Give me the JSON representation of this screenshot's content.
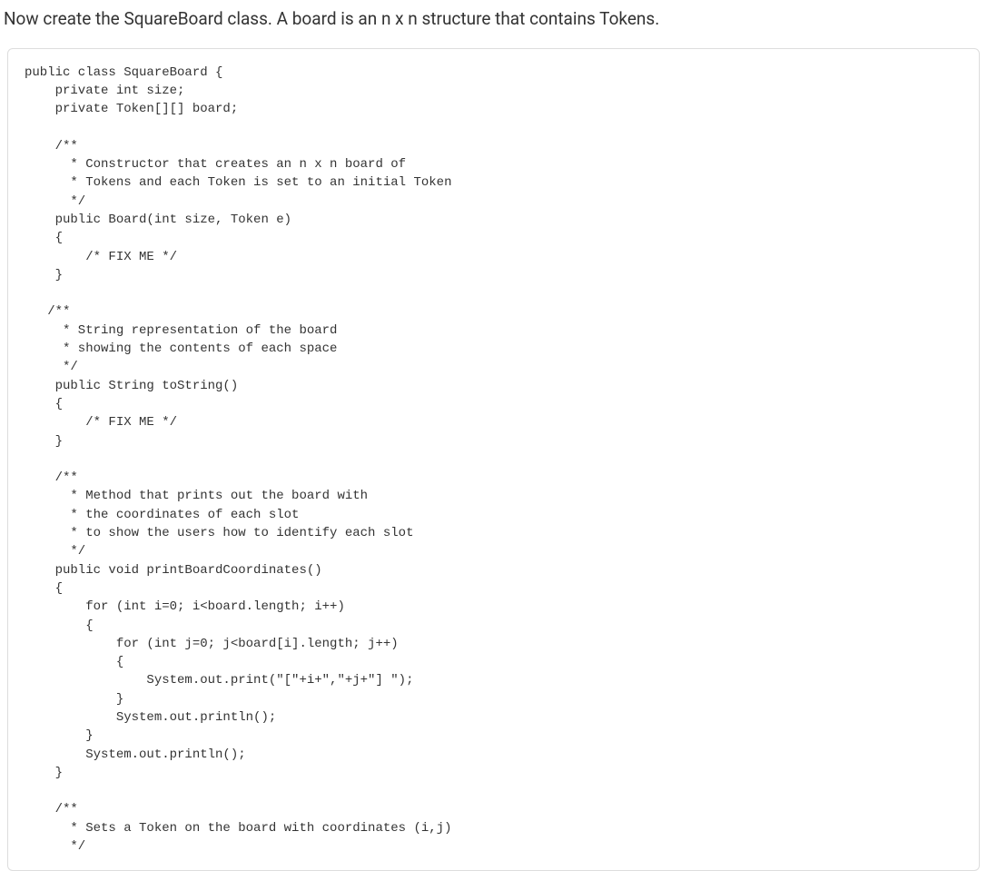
{
  "instruction": "Now create the SquareBoard class. A board is an n x n structure that contains Tokens.",
  "code": "public class SquareBoard {\n    private int size;\n    private Token[][] board;\n\n    /**\n      * Constructor that creates an n x n board of\n      * Tokens and each Token is set to an initial Token\n      */\n    public Board(int size, Token e)\n    {\n        /* FIX ME */\n    }\n\n   /**\n     * String representation of the board\n     * showing the contents of each space\n     */\n    public String toString()\n    {\n        /* FIX ME */\n    }\n\n    /**\n      * Method that prints out the board with\n      * the coordinates of each slot\n      * to show the users how to identify each slot\n      */\n    public void printBoardCoordinates()\n    {\n        for (int i=0; i<board.length; i++)\n        {\n            for (int j=0; j<board[i].length; j++)\n            {\n                System.out.print(\"[\"+i+\",\"+j+\"] \");\n            }\n            System.out.println();\n        }\n        System.out.println();\n    }\n\n    /**\n      * Sets a Token on the board with coordinates (i,j)\n      */"
}
